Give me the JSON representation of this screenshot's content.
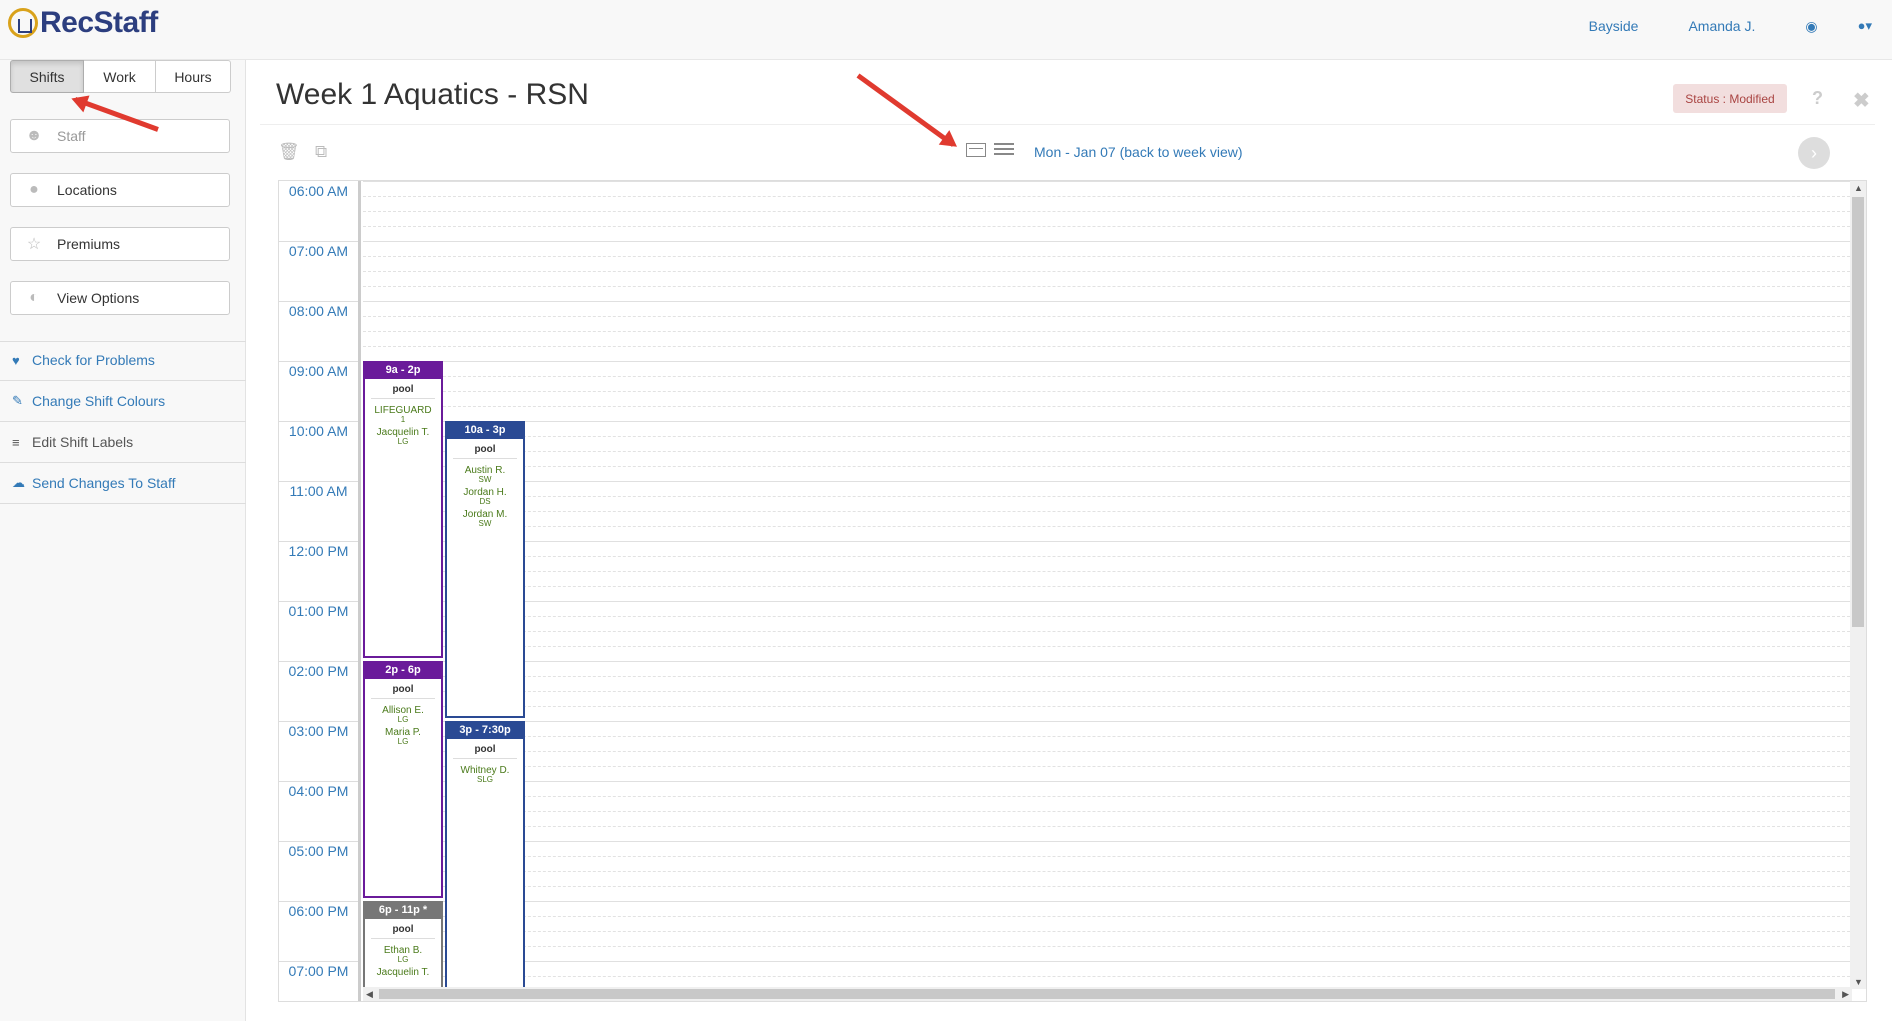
{
  "app": {
    "name": "RecStaff"
  },
  "nav": {
    "site": "Bayside",
    "user": "Amanda J."
  },
  "sidebar": {
    "tabs": [
      "Shifts",
      "Work",
      "Hours"
    ],
    "buttons": [
      "Staff",
      "Locations",
      "Premiums",
      "View Options"
    ],
    "links": [
      "Check for Problems",
      "Change Shift Colours",
      "Edit Shift Labels",
      "Send Changes To Staff"
    ]
  },
  "main": {
    "title": "Week 1 Aquatics - RSN",
    "status": "Status : Modified",
    "day_link": "Mon - Jan 07 (back to week view)",
    "help": "?",
    "close": "✖"
  },
  "calendar": {
    "hours": [
      "06:00 AM",
      "07:00 AM",
      "08:00 AM",
      "09:00 AM",
      "10:00 AM",
      "11:00 AM",
      "12:00 PM",
      "01:00 PM",
      "02:00 PM",
      "03:00 PM",
      "04:00 PM",
      "05:00 PM",
      "06:00 PM",
      "07:00 PM"
    ],
    "shifts": [
      {
        "time": "9a - 2p",
        "color": "purple",
        "location": "pool",
        "staff": [
          {
            "name": "LIFEGUARD",
            "role": "1"
          },
          {
            "name": "Jacquelin T.",
            "role": "LG"
          }
        ]
      },
      {
        "time": "2p - 6p",
        "color": "purple",
        "location": "pool",
        "staff": [
          {
            "name": "Allison E.",
            "role": "LG"
          },
          {
            "name": "Maria P.",
            "role": "LG"
          }
        ]
      },
      {
        "time": "6p - 11p *",
        "color": "grey",
        "location": "pool",
        "staff": [
          {
            "name": "Ethan B.",
            "role": "LG"
          },
          {
            "name": "Jacquelin T.",
            "role": ""
          }
        ]
      },
      {
        "time": "10a - 3p",
        "color": "navy",
        "location": "pool",
        "staff": [
          {
            "name": "Austin R.",
            "role": "SW"
          },
          {
            "name": "Jordan H.",
            "role": "DS"
          },
          {
            "name": "Jordan M.",
            "role": "SW"
          }
        ]
      },
      {
        "time": "3p - 7:30p",
        "color": "navy",
        "location": "pool",
        "staff": [
          {
            "name": "Whitney D.",
            "role": "SLG"
          }
        ]
      }
    ]
  },
  "colors": {
    "purple": "#6a1b9a",
    "navy": "#2a4a94",
    "grey": "#777777",
    "link": "#337ab7",
    "status_bg": "#f2dede"
  }
}
